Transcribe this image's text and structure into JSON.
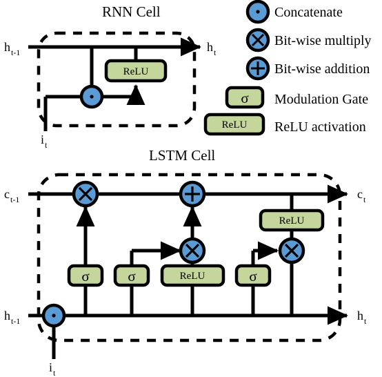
{
  "titles": {
    "rnn": "RNN Cell",
    "lstm": "LSTM Cell"
  },
  "colors": {
    "gate_fill": "#c5d69c",
    "circle_fill": "#5b9bd5",
    "stroke": "#000000",
    "background": "#ffffff"
  },
  "legend": {
    "items": [
      {
        "icon": "concatenate-dot-icon",
        "glyph": "·",
        "label": "Concatenate"
      },
      {
        "icon": "multiply-circle-icon",
        "glyph": "✕",
        "label": "Bit-wise multiply"
      },
      {
        "icon": "addition-circle-icon",
        "glyph": "＋",
        "label": "Bit-wise addition"
      },
      {
        "icon": "sigma-gate-icon",
        "glyph": "σ",
        "label": "Modulation Gate"
      },
      {
        "icon": "relu-gate-icon",
        "glyph": "ReLU",
        "label": "ReLU activation"
      }
    ]
  },
  "rnn": {
    "inputs": [
      {
        "base": "h",
        "sub": "t-1"
      },
      {
        "base": "i",
        "sub": "t"
      }
    ],
    "outputs": [
      {
        "base": "h",
        "sub": "t"
      }
    ],
    "gates": [
      {
        "label": "ReLU"
      }
    ],
    "operators": [
      {
        "type": "concatenate",
        "glyph": "·"
      }
    ]
  },
  "lstm": {
    "inputs": [
      {
        "base": "c",
        "sub": "t-1"
      },
      {
        "base": "h",
        "sub": "t-1"
      },
      {
        "base": "i",
        "sub": "t"
      }
    ],
    "outputs": [
      {
        "base": "c",
        "sub": "t"
      },
      {
        "base": "h",
        "sub": "t"
      }
    ],
    "gates": [
      {
        "label": "σ",
        "name": "forget-gate"
      },
      {
        "label": "σ",
        "name": "input-gate"
      },
      {
        "label": "ReLU",
        "name": "candidate-gate"
      },
      {
        "label": "σ",
        "name": "output-gate"
      },
      {
        "label": "ReLU",
        "name": "cell-activation"
      }
    ],
    "operators": [
      {
        "type": "multiply",
        "glyph": "✕",
        "name": "forget-multiply"
      },
      {
        "type": "addition",
        "glyph": "＋",
        "name": "cell-addition"
      },
      {
        "type": "multiply",
        "glyph": "✕",
        "name": "input-multiply"
      },
      {
        "type": "multiply",
        "glyph": "✕",
        "name": "output-multiply"
      },
      {
        "type": "concatenate",
        "glyph": "·",
        "name": "concatenate"
      }
    ]
  }
}
